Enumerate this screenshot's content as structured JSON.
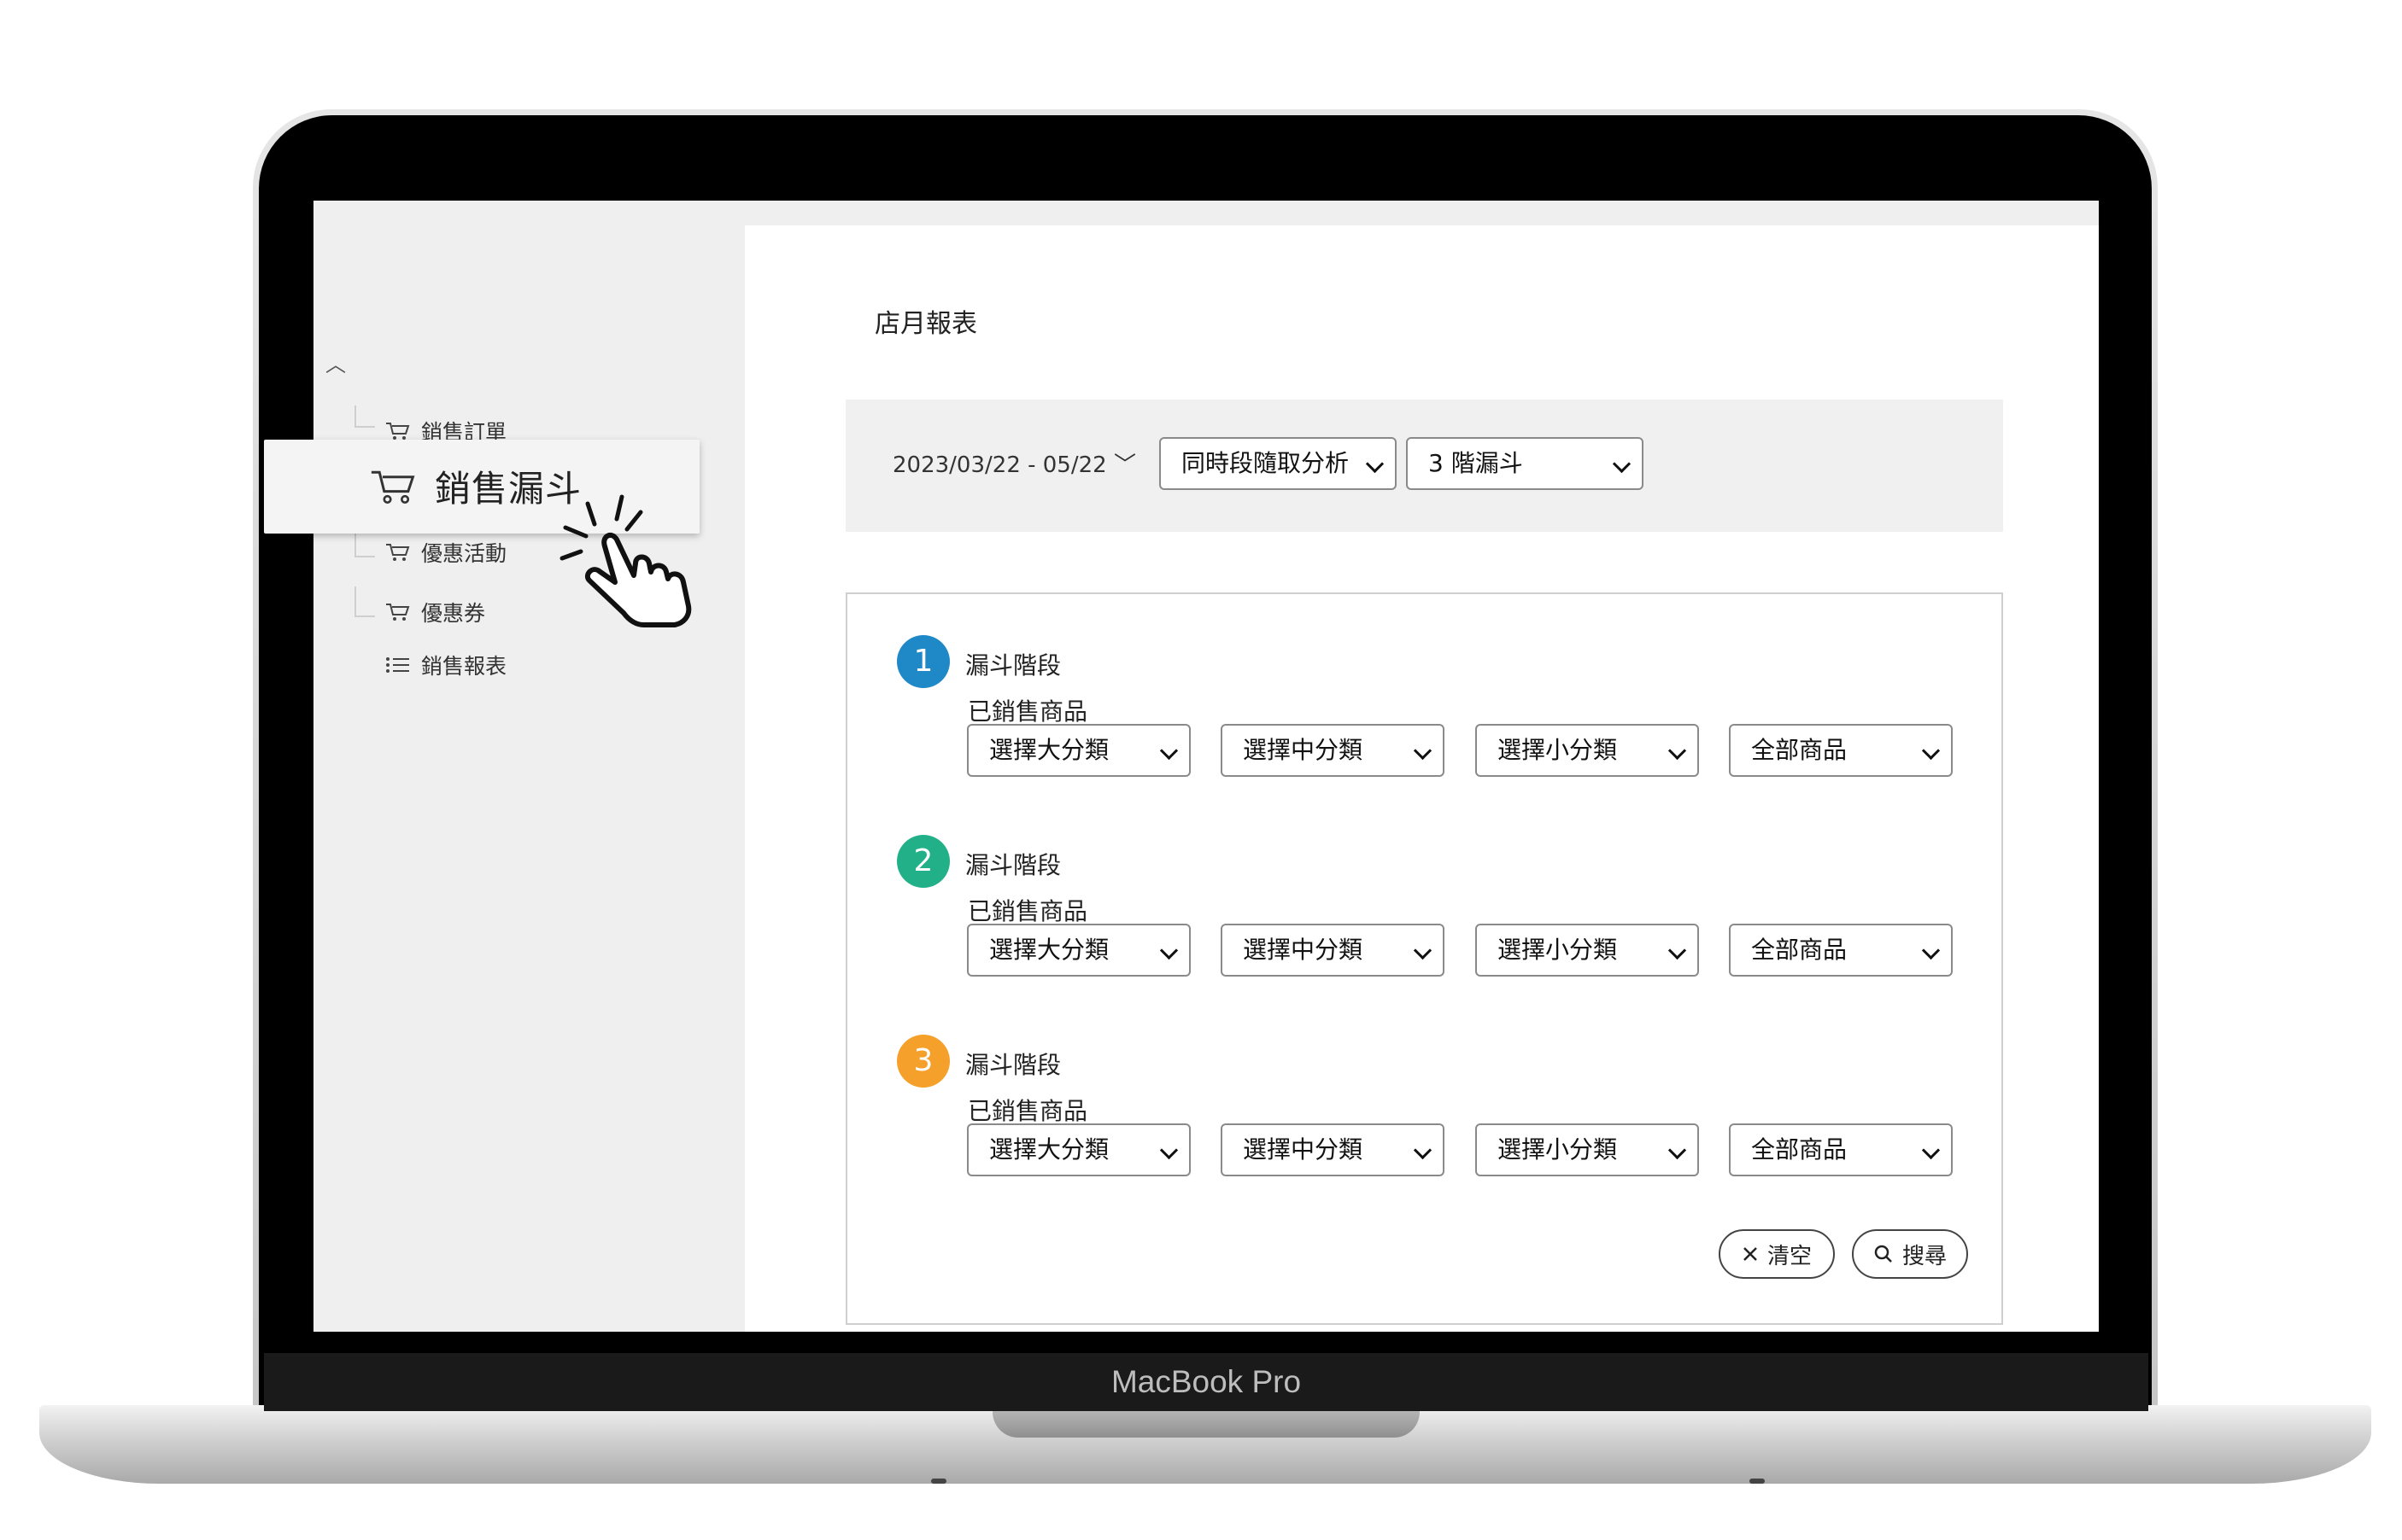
{
  "device": {
    "brand": "MacBook Pro"
  },
  "sidebar": {
    "items": [
      {
        "label": "銷售訂單",
        "icon": "cart-icon"
      },
      {
        "label": "銷售漏斗",
        "icon": "cart-icon"
      },
      {
        "label": "優惠活動",
        "icon": "cart-icon"
      },
      {
        "label": "優惠券",
        "icon": "cart-icon"
      },
      {
        "label": "銷售報表",
        "icon": "list-icon"
      }
    ],
    "highlighted": "銷售漏斗"
  },
  "main": {
    "title": "店月報表",
    "filters": {
      "date_range": "2023/03/22 - 05/22",
      "analysis_mode": "同時段隨取分析",
      "funnel_levels": "3 階漏斗"
    },
    "stages": [
      {
        "number": "1",
        "color": "#1f88c6",
        "label": "漏斗階段",
        "sold_label": "已銷售商品",
        "selects": [
          "選擇大分類",
          "選擇中分類",
          "選擇小分類",
          "全部商品"
        ]
      },
      {
        "number": "2",
        "color": "#22b089",
        "label": "漏斗階段",
        "sold_label": "已銷售商品",
        "selects": [
          "選擇大分類",
          "選擇中分類",
          "選擇小分類",
          "全部商品"
        ]
      },
      {
        "number": "3",
        "color": "#f5a02a",
        "label": "漏斗階段",
        "sold_label": "已銷售商品",
        "selects": [
          "選擇大分類",
          "選擇中分類",
          "選擇小分類",
          "全部商品"
        ]
      }
    ],
    "actions": {
      "clear_label": "清空",
      "search_label": "搜尋"
    }
  }
}
